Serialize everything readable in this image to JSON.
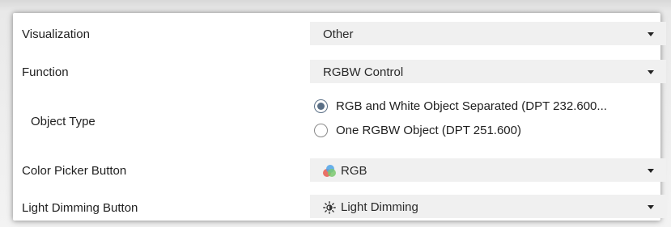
{
  "rows": {
    "visualization": {
      "label": "Visualization",
      "value": "Other"
    },
    "function": {
      "label": "Function",
      "value": "RGBW Control"
    },
    "object_type": {
      "label": "Object Type",
      "options": [
        {
          "label": "RGB and White Object Separated (DPT 232.600...",
          "checked": true
        },
        {
          "label": "One RGBW Object (DPT 251.600)",
          "checked": false
        }
      ]
    },
    "color_picker": {
      "label": "Color Picker Button",
      "value": "RGB",
      "icon": "rgb-circles-icon"
    },
    "light_dimming": {
      "label": "Light Dimming Button",
      "value": "Light Dimming",
      "icon": "sun-icon"
    }
  },
  "colors": {
    "radio_accent": "#5a6f86",
    "select_bg": "#f0f0f0",
    "rgb_icon": [
      "#e85a4f",
      "#4fa3e8",
      "#7bc96f"
    ]
  }
}
